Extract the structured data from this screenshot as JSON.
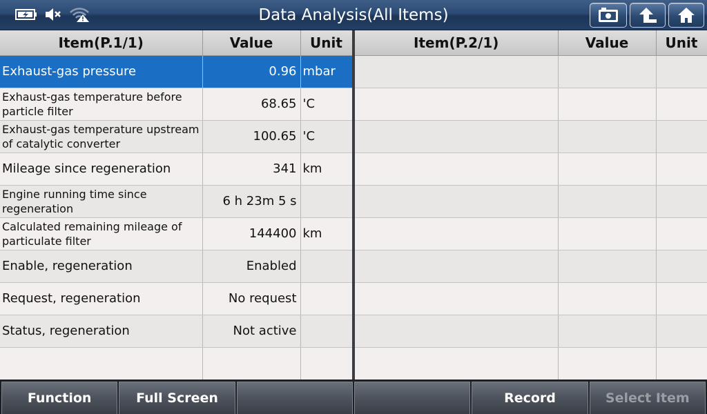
{
  "header": {
    "title": "Data Analysis(All Items)"
  },
  "left_table": {
    "columns": {
      "item": "Item(P.1/1)",
      "value": "Value",
      "unit": "Unit"
    },
    "rows": [
      {
        "item": "Exhaust-gas pressure",
        "value": "0.96",
        "unit": "mbar"
      },
      {
        "item": "Exhaust-gas temperature before particle filter",
        "value": "68.65",
        "unit": "'C"
      },
      {
        "item": "Exhaust-gas temperature upstream of catalytic converter",
        "value": "100.65",
        "unit": "'C"
      },
      {
        "item": "Mileage since regeneration",
        "value": "341",
        "unit": "km"
      },
      {
        "item": "Engine running time since regeneration",
        "value": "6 h 23m 5 s",
        "unit": ""
      },
      {
        "item": "Calculated remaining mileage of particulate filter",
        "value": "144400",
        "unit": "km"
      },
      {
        "item": "Enable, regeneration",
        "value": "Enabled",
        "unit": ""
      },
      {
        "item": "Request, regeneration",
        "value": "No request",
        "unit": ""
      },
      {
        "item": "Status, regeneration",
        "value": "Not active",
        "unit": ""
      },
      {
        "item": "",
        "value": "",
        "unit": ""
      }
    ]
  },
  "right_table": {
    "columns": {
      "item": "Item(P.2/1)",
      "value": "Value",
      "unit": "Unit"
    }
  },
  "toolbar": {
    "function_label": "Function",
    "full_screen_label": "Full Screen",
    "empty_1_label": "",
    "empty_2_label": "",
    "record_label": "Record",
    "select_item_label": "Select Item"
  },
  "colors": {
    "selected_row": "#1a6fc4",
    "title_bar": "#2b4a73"
  }
}
